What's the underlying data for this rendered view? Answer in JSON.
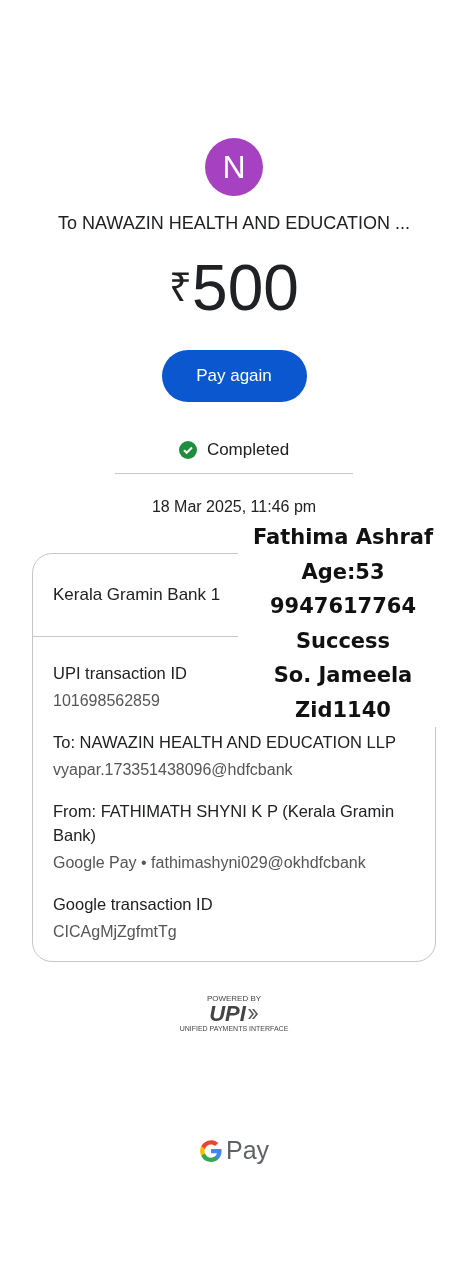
{
  "payee": {
    "initial": "N",
    "color": "#a642c2",
    "title": "To NAWAZIN HEALTH AND EDUCATION ..."
  },
  "amount": {
    "currency": "₹",
    "value": "500"
  },
  "action": {
    "label": "Pay again"
  },
  "status": {
    "label": "Completed",
    "kind": "success"
  },
  "date": "18 Mar 2025, 11:46 pm",
  "details": {
    "bank": "Kerala Gramin Bank 1",
    "fields": [
      {
        "label": "UPI transaction ID",
        "value": "101698562859"
      },
      {
        "label": "To: NAWAZIN HEALTH AND EDUCATION LLP",
        "value": "vyapar.173351438096@hdfcbank"
      },
      {
        "label": "From: FATHIMATH SHYNI K P (Kerala Gramin Bank)",
        "value": "Google Pay • fathimashyni029@okhdfcbank"
      },
      {
        "label": "Google transaction ID",
        "value": "CICAgMjZgfmtTg"
      }
    ]
  },
  "overlay_note": [
    "Fathima Ashraf",
    "Age:53",
    "9947617764",
    "Success",
    "So. Jameela",
    "Zid1140"
  ],
  "upi_badge": {
    "top": "POWERED BY",
    "logo": "UPI",
    "tagline": "UNIFIED PAYMENTS INTERFACE"
  },
  "footer": {
    "brand": "Pay"
  }
}
